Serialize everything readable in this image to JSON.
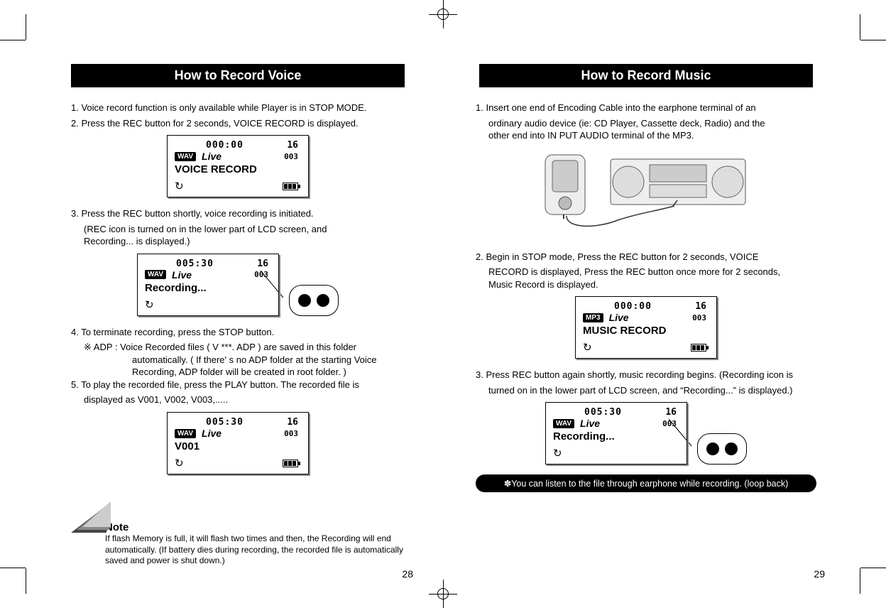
{
  "left": {
    "heading": "How to Record Voice",
    "page_number": "28",
    "steps": {
      "s1": "1. Voice record function is only available while Player is in STOP MODE.",
      "s2": "2. Press the REC button for 2 seconds, VOICE RECORD is displayed.",
      "s3": "3. Press the REC button shortly, voice recording is initiated.",
      "s3a": "(REC icon is turned on in the lower part of LCD screen, and",
      "s3b": " Recording... is displayed.)",
      "s4": "4. To terminate recording, press the STOP button.",
      "s4_sym": "※",
      "s4a": " ADP : Voice Recorded files ( V ***. ADP ) are saved in this folder",
      "s4b": "automatically. ( If there' s no ADP folder at the starting Voice",
      "s4c": "Recording,  ADP folder will be created in root folder. )",
      "s5": "5. To play the recorded file, press the PLAY button. The recorded file is",
      "s5a": "displayed as V001, V002, V003,....."
    },
    "lcd1": {
      "time": "000:00",
      "tracks": "16",
      "sub": "003",
      "badge": "WAV",
      "live": "Live",
      "big": "VOICE RECORD"
    },
    "lcd2": {
      "time": "005:30",
      "tracks": "16",
      "sub": "003",
      "badge": "WAV",
      "live": "Live",
      "big": "Recording..."
    },
    "lcd3": {
      "time": "005:30",
      "tracks": "16",
      "sub": "003",
      "badge": "WAV",
      "live": "Live",
      "big": "V001"
    },
    "note": {
      "label": "Note",
      "text": "If flash Memory is full, it will flash two times and then, the Recording will end automatically. (If battery dies during recording, the recorded file is automatically saved and power is shut down.)"
    }
  },
  "right": {
    "heading": "How to Record Music",
    "page_number": "29",
    "steps": {
      "s1": "1. Insert one end of Encoding Cable into the earphone terminal of an",
      "s1a": "ordinary audio device (ie: CD Player, Cassette deck, Radio) and the",
      "s1b": "other end into IN PUT AUDIO terminal of the MP3.",
      "s2": "2. Begin in STOP mode, Press the REC button for 2 seconds, VOICE",
      "s2a": "RECORD is displayed, Press the REC button once more for 2 seconds,",
      "s2b": "Music Record is displayed.",
      "s3": "3. Press REC button again shortly, music recording begins. (Recording icon is",
      "s3a": "turned on in the lower part of LCD screen, and “Recording...” is displayed.)"
    },
    "lcd1": {
      "time": "000:00",
      "tracks": "16",
      "sub": "003",
      "badge": "MP3",
      "live": "Live",
      "big": "MUSIC RECORD"
    },
    "lcd2": {
      "time": "005:30",
      "tracks": "16",
      "sub": "003",
      "badge": "WAV",
      "live": "Live",
      "big": "Recording..."
    },
    "callout_sym": "✽",
    "callout": "You can listen to the file through earphone while recording. (loop back)"
  }
}
